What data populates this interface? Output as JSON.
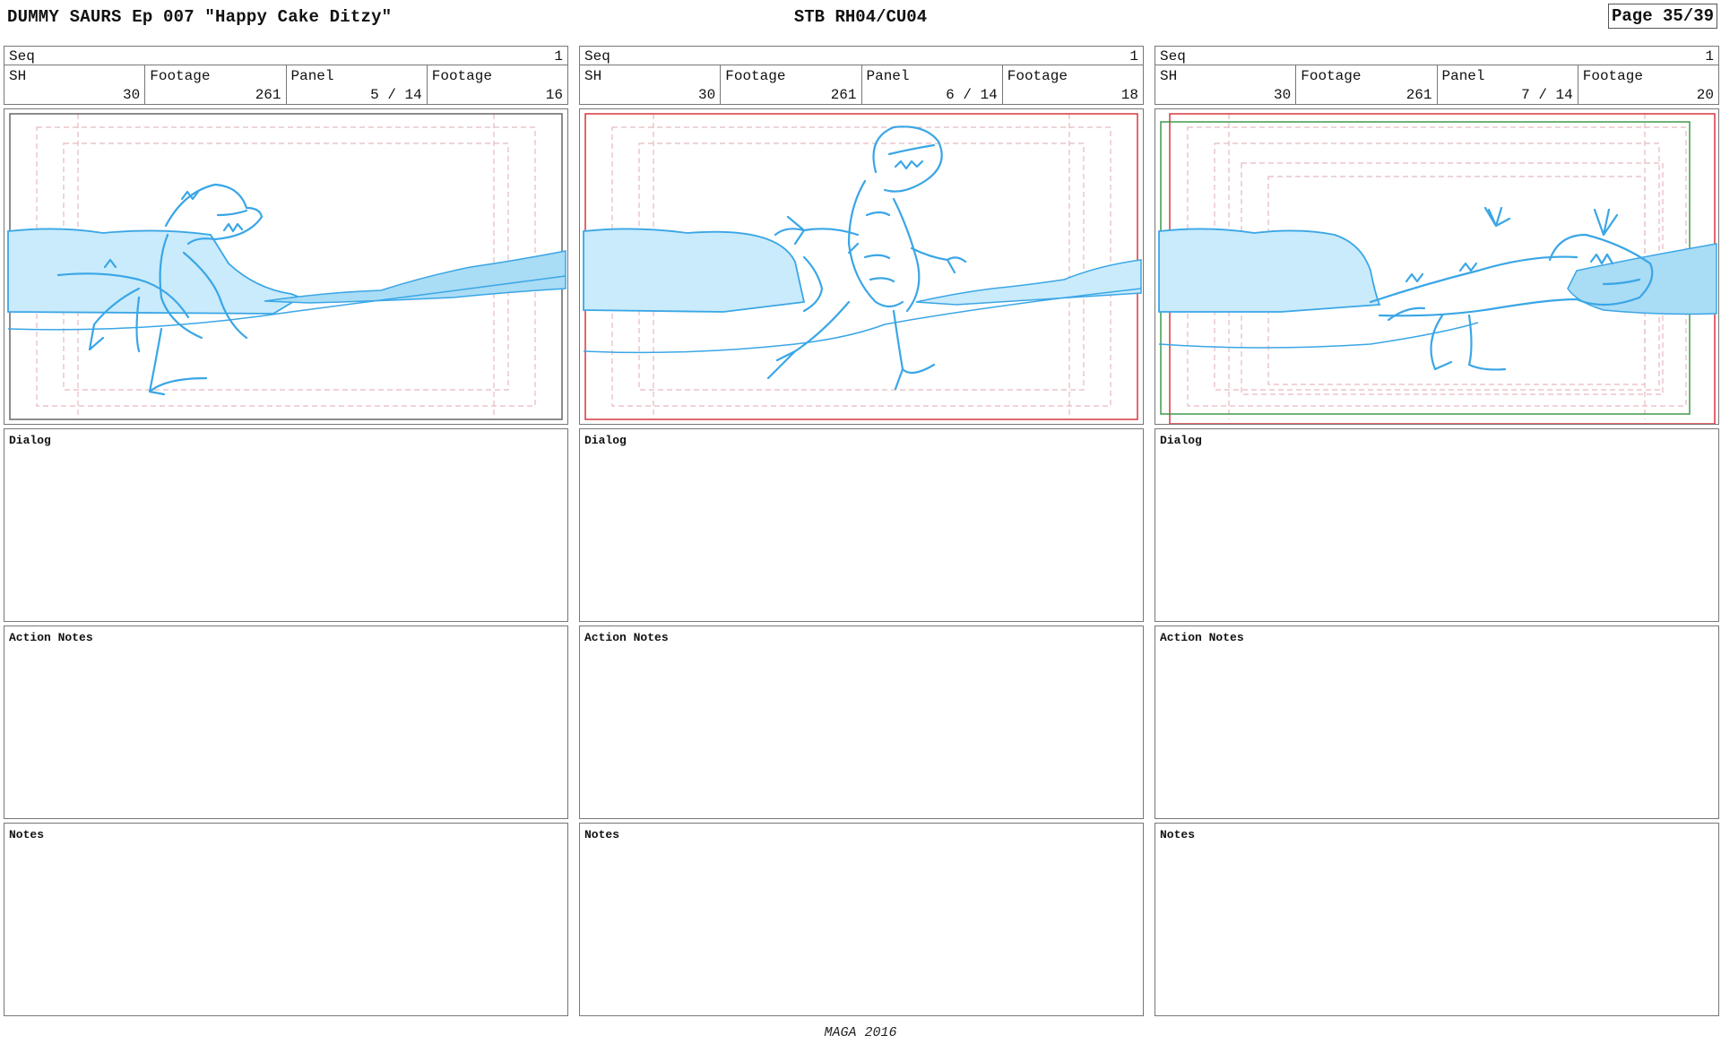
{
  "header": {
    "title": "DUMMY SAURS  Ep 007 \"Happy Cake Ditzy\"",
    "stb": "STB RH04/CU04",
    "page": "Page 35/39"
  },
  "labels": {
    "seq": "Seq",
    "sh": "SH",
    "footage": "Footage",
    "panel": "Panel",
    "dialog": "Dialog",
    "action_notes": "Action Notes",
    "notes": "Notes"
  },
  "panels": [
    {
      "seq": "1",
      "sh": "30",
      "footage": "261",
      "panel": "5 / 14",
      "panel_footage": "16"
    },
    {
      "seq": "1",
      "sh": "30",
      "footage": "261",
      "panel": "6 / 14",
      "panel_footage": "18"
    },
    {
      "seq": "1",
      "sh": "30",
      "footage": "261",
      "panel": "7 / 14",
      "panel_footage": "20"
    }
  ],
  "colors": {
    "sketch": "#3aa6e6",
    "sketch_fill": "#c9ebfb",
    "camera_red": "#d9363e",
    "camera_green": "#3e9b4a",
    "safe_guide": "#e6b9bf"
  },
  "footer": "MAGA 2016"
}
